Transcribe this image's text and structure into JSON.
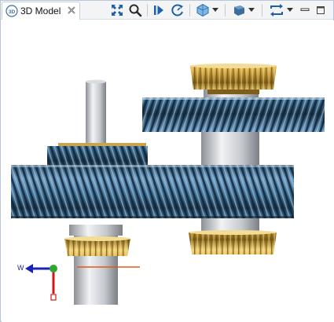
{
  "tab": {
    "title": "3D Model",
    "icon": "3d-model-icon"
  },
  "toolbar": {
    "items": [
      {
        "name": "fit-to-view-icon"
      },
      {
        "name": "zoom-icon"
      },
      {
        "name": "play-icon"
      },
      {
        "name": "rotate-icon"
      },
      {
        "name": "display-style-icon"
      },
      {
        "name": "shading-icon"
      },
      {
        "name": "orientation-icon"
      }
    ]
  },
  "axis_triad": {
    "x_label": "W"
  },
  "colors": {
    "gear_blue": "#3f6f93",
    "gear_gold": "#d9b45a",
    "shaft_gray": "#b8bcc2",
    "accent_red": "#e05a1a",
    "axis_blue": "#1a22b8",
    "axis_green": "#2ca82c",
    "axis_red": "#cc1a1a"
  }
}
